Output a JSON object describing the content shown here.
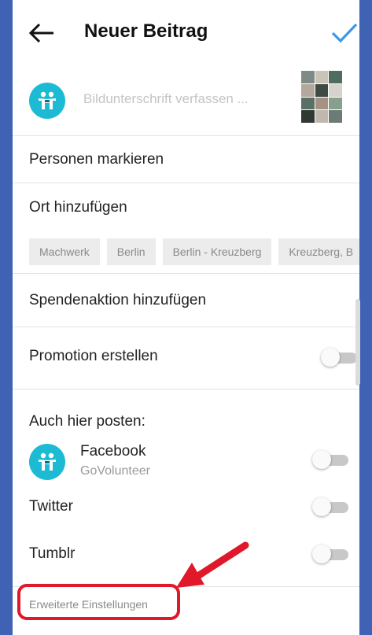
{
  "header": {
    "title": "Neuer Beitrag",
    "back_icon": "arrow-left-icon",
    "confirm_icon": "checkmark-icon",
    "accent_color": "#3897f0"
  },
  "caption": {
    "placeholder": "Bildunterschrift verfassen ...",
    "avatar_icon": "govolunteer-logo-icon"
  },
  "options": {
    "tag_people": "Personen markieren",
    "add_location": "Ort hinzufügen",
    "location_suggestions": [
      "Machwerk",
      "Berlin",
      "Berlin - Kreuzberg",
      "Kreuzberg, B"
    ],
    "add_fundraiser": "Spendenaktion hinzufügen",
    "create_promotion": "Promotion erstellen",
    "create_promotion_toggle": false
  },
  "share": {
    "heading": "Auch hier posten:",
    "facebook": {
      "name": "Facebook",
      "account": "GoVolunteer",
      "enabled": false
    },
    "twitter": {
      "name": "Twitter",
      "enabled": false
    },
    "tumblr": {
      "name": "Tumblr",
      "enabled": false
    }
  },
  "advanced_settings": "Erweiterte Einstellungen",
  "annotation_color": "#e0182a",
  "background_color": "#3f62b4"
}
